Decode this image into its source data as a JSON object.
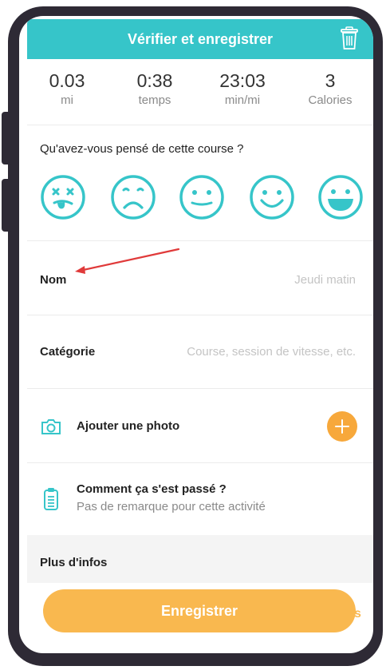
{
  "header": {
    "title": "Vérifier et enregistrer",
    "trash_icon": "trash-icon"
  },
  "stats": [
    {
      "value": "0.03",
      "label": "mi"
    },
    {
      "value": "0:38",
      "label": "temps"
    },
    {
      "value": "23:03",
      "label": "min/mi"
    },
    {
      "value": "3",
      "label": "Calories"
    }
  ],
  "feeling": {
    "question": "Qu'avez-vous pensé de cette course ?",
    "faces": [
      "dizzy-face-icon",
      "sad-face-icon",
      "neutral-face-icon",
      "smile-face-icon",
      "grin-face-icon"
    ]
  },
  "name_row": {
    "label": "Nom",
    "placeholder": "Jeudi matin"
  },
  "category_row": {
    "label": "Catégorie",
    "placeholder": "Course, session de vitesse, etc."
  },
  "photo_row": {
    "label": "Ajouter une photo",
    "icon": "camera-icon",
    "action_icon": "plus-icon"
  },
  "comment_row": {
    "title": "Comment ça s'est passé ?",
    "subtitle": "Pas de remarque pour cette activité",
    "icon": "clipboard-icon"
  },
  "more_info": {
    "label": "Plus d'infos"
  },
  "save": {
    "label": "Enregistrer",
    "peek": "s"
  },
  "colors": {
    "teal": "#36c5c9",
    "orange": "#f7a83b",
    "arrow": "#e03a3a"
  }
}
